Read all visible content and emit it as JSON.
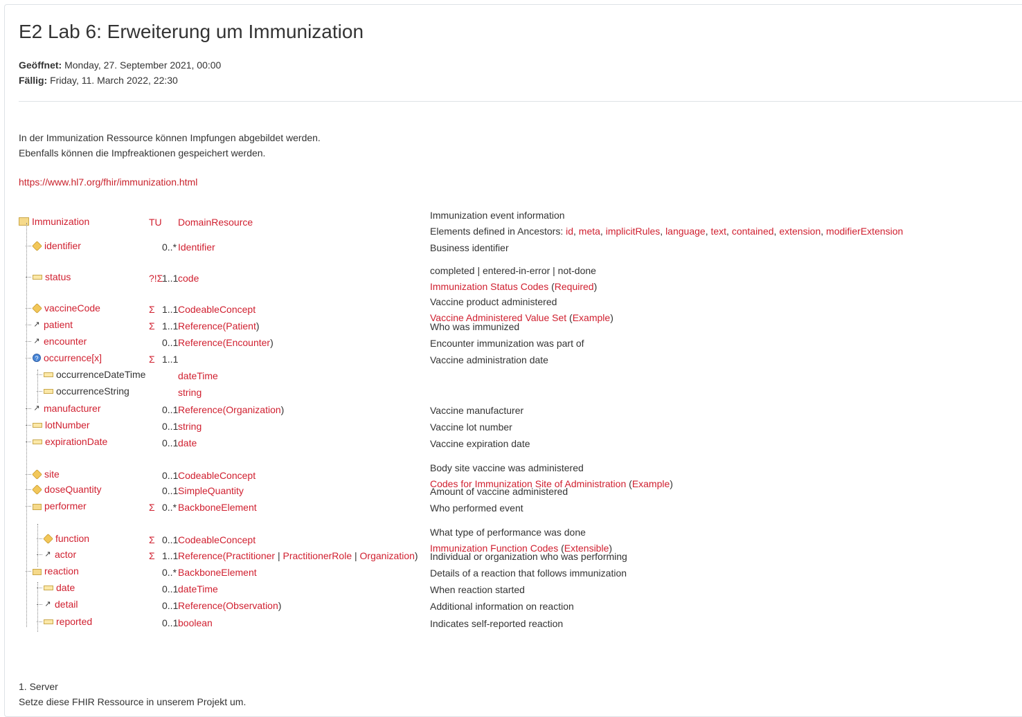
{
  "page": {
    "title": "E2 Lab 6: Erweiterung um Immunization",
    "opened_label": "Geöffnet:",
    "opened_value": "Monday, 27. September 2021, 00:00",
    "due_label": "Fällig:",
    "due_value": "Friday, 11. March 2022, 22:30",
    "intro_line1": "In der Immunization Ressource können Impfungen abgebildet werden.",
    "intro_line2": "Ebenfalls können die Impfreaktionen gespeichert werden.",
    "link": "https://www.hl7.org/fhir/immunization.html",
    "footer_line1": "1. Server",
    "footer_line2": "Setze diese FHIR Ressource in unserem Projekt um."
  },
  "table": {
    "root": {
      "name": "Immunization",
      "flags": "TU",
      "type": "DomainResource",
      "desc1": "Immunization event information",
      "ancestors_label": "Elements defined in Ancestors:",
      "ancestors": [
        "id",
        "meta",
        "implicitRules",
        "language",
        "text",
        "contained",
        "extension",
        "modifierExtension"
      ]
    },
    "rows": [
      {
        "name": "identifier",
        "flags": "",
        "card": "0..*",
        "type": "Identifier",
        "desc": "Business identifier",
        "icon": "cube-icon"
      },
      {
        "name": "status",
        "flags": "?!Σ",
        "card": "1..1",
        "type": "code",
        "desc": "completed | entered-in-error | not-done",
        "binding": "Immunization Status Codes",
        "strength": "Required",
        "icon": "primitive-icon"
      },
      {
        "name": "vaccineCode",
        "flags": "Σ",
        "card": "1..1",
        "type": "CodeableConcept",
        "desc": "Vaccine product administered",
        "binding": "Vaccine Administered Value Set",
        "strength": "Example",
        "icon": "cube-icon"
      },
      {
        "name": "patient",
        "flags": "Σ",
        "card": "1..1",
        "type": "Reference",
        "targets": [
          "Patient"
        ],
        "desc": "Who was immunized",
        "icon": "reference-icon"
      },
      {
        "name": "encounter",
        "flags": "",
        "card": "0..1",
        "type": "Reference",
        "targets": [
          "Encounter"
        ],
        "desc": "Encounter immunization was part of",
        "icon": "reference-icon"
      },
      {
        "name": "occurrence[x]",
        "flags": "Σ",
        "card": "1..1",
        "type": "",
        "desc": "Vaccine administration date",
        "icon": "choice-icon"
      },
      {
        "name": "occurrenceDateTime",
        "flags": "",
        "card": "",
        "type": "dateTime",
        "desc": "",
        "icon": "primitive-icon"
      },
      {
        "name": "occurrenceString",
        "flags": "",
        "card": "",
        "type": "string",
        "desc": "",
        "icon": "primitive-icon"
      },
      {
        "name": "manufacturer",
        "flags": "",
        "card": "0..1",
        "type": "Reference",
        "targets": [
          "Organization"
        ],
        "desc": "Vaccine manufacturer",
        "icon": "reference-icon"
      },
      {
        "name": "lotNumber",
        "flags": "",
        "card": "0..1",
        "type": "string",
        "desc": "Vaccine lot number",
        "icon": "primitive-icon"
      },
      {
        "name": "expirationDate",
        "flags": "",
        "card": "0..1",
        "type": "date",
        "desc": "Vaccine expiration date",
        "icon": "primitive-icon"
      },
      {
        "name": "site",
        "flags": "",
        "card": "0..1",
        "type": "CodeableConcept",
        "desc": "Body site vaccine was administered",
        "binding": "Codes for Immunization Site of Administration",
        "strength": "Example",
        "icon": "cube-icon"
      },
      {
        "name": "doseQuantity",
        "flags": "",
        "card": "0..1",
        "type": "SimpleQuantity",
        "desc": "Amount of vaccine administered",
        "icon": "cube-icon"
      },
      {
        "name": "performer",
        "flags": "Σ",
        "card": "0..*",
        "type": "BackboneElement",
        "desc": "Who performed event",
        "icon": "folder-icon"
      },
      {
        "name": "function",
        "flags": "Σ",
        "card": "0..1",
        "type": "CodeableConcept",
        "desc": "What type of performance was done",
        "binding": "Immunization Function Codes",
        "strength": "Extensible",
        "icon": "cube-icon"
      },
      {
        "name": "actor",
        "flags": "Σ",
        "card": "1..1",
        "type": "Reference",
        "targets": [
          "Practitioner",
          "PractitionerRole",
          "Organization"
        ],
        "desc": "Individual or organization who was performing",
        "icon": "reference-icon"
      },
      {
        "name": "reaction",
        "flags": "",
        "card": "0..*",
        "type": "BackboneElement",
        "desc": "Details of a reaction that follows immunization",
        "icon": "folder-icon"
      },
      {
        "name": "date",
        "flags": "",
        "card": "0..1",
        "type": "dateTime",
        "desc": "When reaction started",
        "icon": "primitive-icon"
      },
      {
        "name": "detail",
        "flags": "",
        "card": "0..1",
        "type": "Reference",
        "targets": [
          "Observation"
        ],
        "desc": "Additional information on reaction",
        "icon": "reference-icon"
      },
      {
        "name": "reported",
        "flags": "",
        "card": "0..1",
        "type": "boolean",
        "desc": "Indicates self-reported reaction",
        "icon": "primitive-icon"
      }
    ]
  }
}
